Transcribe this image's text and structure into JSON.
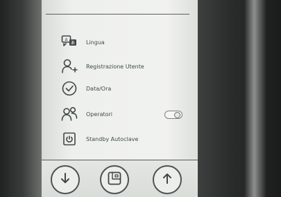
{
  "menu": {
    "items": [
      {
        "label": "Lingua",
        "icon": "language-icon"
      },
      {
        "label": "Registrazione Utente",
        "icon": "add-user-icon"
      },
      {
        "label": "Data/Ora",
        "icon": "clock-icon"
      },
      {
        "label": "Operatori",
        "icon": "operators-icon"
      },
      {
        "label": "Standby Autoclave",
        "icon": "standby-power-icon"
      }
    ]
  },
  "operators_toggle": {
    "state": "on"
  },
  "bottom_bar": {
    "buttons": [
      {
        "name": "scroll-down-button",
        "icon": "arrow-down-icon"
      },
      {
        "name": "home-button",
        "icon": "home-screen-icon"
      },
      {
        "name": "scroll-up-button",
        "icon": "arrow-up-icon"
      }
    ]
  }
}
